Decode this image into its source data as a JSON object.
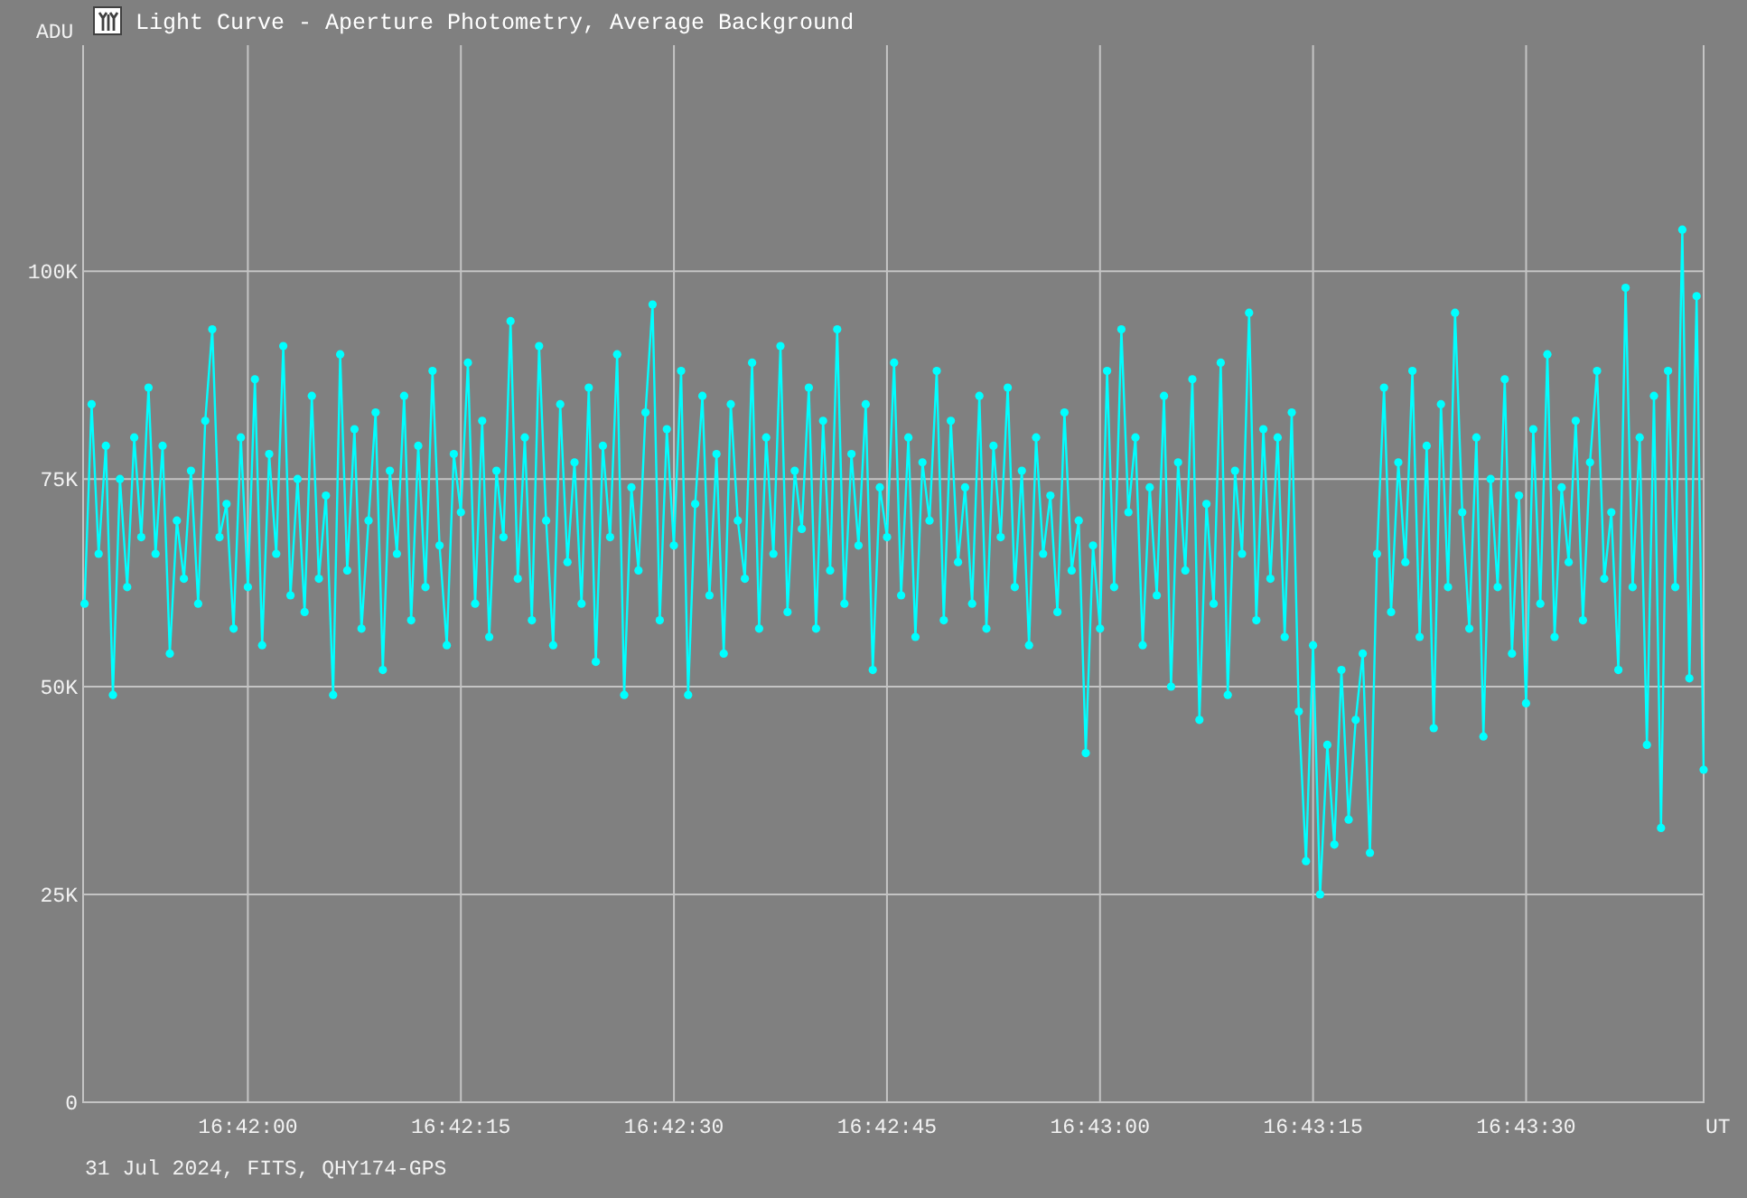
{
  "window": {
    "title": "Light Curve - Aperture Photometry, Average Background"
  },
  "chart": {
    "chart_data": {
      "type": "line",
      "grid": true,
      "xlabel": "UT",
      "ylabel": "ADU",
      "xlim": [
        60108.4,
        60222.5
      ],
      "ylim": [
        0,
        127200
      ],
      "xticks": [
        {
          "value": 60120,
          "label": "16:42:00"
        },
        {
          "value": 60135,
          "label": "16:42:15"
        },
        {
          "value": 60150,
          "label": "16:42:30"
        },
        {
          "value": 60165,
          "label": "16:42:45"
        },
        {
          "value": 60180,
          "label": "16:43:00"
        },
        {
          "value": 60195,
          "label": "16:43:15"
        },
        {
          "value": 60210,
          "label": "16:43:30"
        }
      ],
      "yticks": [
        {
          "value": 0,
          "label": "0"
        },
        {
          "value": 25000,
          "label": "25K"
        },
        {
          "value": 50000,
          "label": "50K"
        },
        {
          "value": 75000,
          "label": "75K"
        },
        {
          "value": 100000,
          "label": "100K"
        }
      ],
      "x": [
        60108.5,
        60109,
        60109.5,
        60110,
        60110.5,
        60111,
        60111.5,
        60112,
        60112.5,
        60113,
        60113.5,
        60114,
        60114.5,
        60115,
        60115.5,
        60116,
        60116.5,
        60117,
        60117.5,
        60118,
        60118.5,
        60119,
        60119.5,
        60120,
        60120.5,
        60121,
        60121.5,
        60122,
        60122.5,
        60123,
        60123.5,
        60124,
        60124.5,
        60125,
        60125.5,
        60126,
        60126.5,
        60127,
        60127.5,
        60128,
        60128.5,
        60129,
        60129.5,
        60130,
        60130.5,
        60131,
        60131.5,
        60132,
        60132.5,
        60133,
        60133.5,
        60134,
        60134.5,
        60135,
        60135.5,
        60136,
        60136.5,
        60137,
        60137.5,
        60138,
        60138.5,
        60139,
        60139.5,
        60140,
        60140.5,
        60141,
        60141.5,
        60142,
        60142.5,
        60143,
        60143.5,
        60144,
        60144.5,
        60145,
        60145.5,
        60146,
        60146.5,
        60147,
        60147.5,
        60148,
        60148.5,
        60149,
        60149.5,
        60150,
        60150.5,
        60151,
        60151.5,
        60152,
        60152.5,
        60153,
        60153.5,
        60154,
        60154.5,
        60155,
        60155.5,
        60156,
        60156.5,
        60157,
        60157.5,
        60158,
        60158.5,
        60159,
        60159.5,
        60160,
        60160.5,
        60161,
        60161.5,
        60162,
        60162.5,
        60163,
        60163.5,
        60164,
        60164.5,
        60165,
        60165.5,
        60166,
        60166.5,
        60167,
        60167.5,
        60168,
        60168.5,
        60169,
        60169.5,
        60170,
        60170.5,
        60171,
        60171.5,
        60172,
        60172.5,
        60173,
        60173.5,
        60174,
        60174.5,
        60175,
        60175.5,
        60176,
        60176.5,
        60177,
        60177.5,
        60178,
        60178.5,
        60179,
        60179.5,
        60180,
        60180.5,
        60181,
        60181.5,
        60182,
        60182.5,
        60183,
        60183.5,
        60184,
        60184.5,
        60185,
        60185.5,
        60186,
        60186.5,
        60187,
        60187.5,
        60188,
        60188.5,
        60189,
        60189.5,
        60190,
        60190.5,
        60191,
        60191.5,
        60192,
        60192.5,
        60193,
        60193.5,
        60194,
        60194.5,
        60195,
        60195.5,
        60196,
        60196.5,
        60197,
        60197.5,
        60198,
        60198.5,
        60199,
        60199.5,
        60200,
        60200.5,
        60201,
        60201.5,
        60202,
        60202.5,
        60203,
        60203.5,
        60204,
        60204.5,
        60205,
        60205.5,
        60206,
        60206.5,
        60207,
        60207.5,
        60208,
        60208.5,
        60209,
        60209.5,
        60210,
        60210.5,
        60211,
        60211.5,
        60212,
        60212.5,
        60213,
        60213.5,
        60214,
        60214.5,
        60215,
        60215.5,
        60216,
        60216.5,
        60217,
        60217.5,
        60218,
        60218.5,
        60219,
        60219.5,
        60220,
        60220.5,
        60221,
        60221.5,
        60222,
        60222.5
      ],
      "series": [
        {
          "color": "#00ffff",
          "values": [
            60000,
            84000,
            66000,
            79000,
            49000,
            75000,
            62000,
            80000,
            68000,
            86000,
            66000,
            79000,
            54000,
            70000,
            63000,
            76000,
            60000,
            82000,
            93000,
            68000,
            72000,
            57000,
            80000,
            62000,
            87000,
            55000,
            78000,
            66000,
            91000,
            61000,
            75000,
            59000,
            85000,
            63000,
            73000,
            49000,
            90000,
            64000,
            81000,
            57000,
            70000,
            83000,
            52000,
            76000,
            66000,
            85000,
            58000,
            79000,
            62000,
            88000,
            67000,
            55000,
            78000,
            71000,
            89000,
            60000,
            82000,
            56000,
            76000,
            68000,
            94000,
            63000,
            80000,
            58000,
            91000,
            70000,
            55000,
            84000,
            65000,
            77000,
            60000,
            86000,
            53000,
            79000,
            68000,
            90000,
            49000,
            74000,
            64000,
            83000,
            96000,
            58000,
            81000,
            67000,
            88000,
            49000,
            72000,
            85000,
            61000,
            78000,
            54000,
            84000,
            70000,
            63000,
            89000,
            57000,
            80000,
            66000,
            91000,
            59000,
            76000,
            69000,
            86000,
            57000,
            82000,
            64000,
            93000,
            60000,
            78000,
            67000,
            84000,
            52000,
            74000,
            68000,
            89000,
            61000,
            80000,
            56000,
            77000,
            70000,
            88000,
            58000,
            82000,
            65000,
            74000,
            60000,
            85000,
            57000,
            79000,
            68000,
            86000,
            62000,
            76000,
            55000,
            80000,
            66000,
            73000,
            59000,
            83000,
            64000,
            70000,
            42000,
            67000,
            57000,
            88000,
            62000,
            93000,
            71000,
            80000,
            55000,
            74000,
            61000,
            85000,
            50000,
            77000,
            64000,
            87000,
            46000,
            72000,
            60000,
            89000,
            49000,
            76000,
            66000,
            95000,
            58000,
            81000,
            63000,
            80000,
            56000,
            83000,
            47000,
            29000,
            55000,
            25000,
            43000,
            31000,
            52000,
            34000,
            46000,
            54000,
            30000,
            66000,
            86000,
            59000,
            77000,
            65000,
            88000,
            56000,
            79000,
            45000,
            84000,
            62000,
            95000,
            71000,
            57000,
            80000,
            44000,
            75000,
            62000,
            87000,
            54000,
            73000,
            48000,
            81000,
            60000,
            90000,
            56000,
            74000,
            65000,
            82000,
            58000,
            77000,
            88000,
            63000,
            71000,
            52000,
            98000,
            62000,
            80000,
            43000,
            85000,
            33000,
            88000,
            62000,
            105000,
            51000,
            97000,
            40000
          ]
        }
      ]
    }
  },
  "footer": "31 Jul 2024, FITS, QHY174-GPS"
}
